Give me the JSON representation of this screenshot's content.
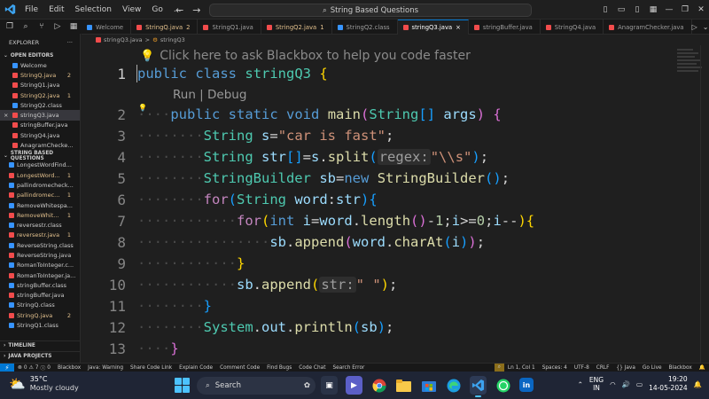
{
  "titlebar": {
    "menu": [
      "File",
      "Edit",
      "Selection",
      "View",
      "Go",
      "..."
    ],
    "search": "String Based Questions"
  },
  "tabs": [
    {
      "label": "Welcome",
      "icon": "vscode-icon",
      "marker": ""
    },
    {
      "label": "StringQ.java",
      "icon": "java-icon",
      "marker": "2",
      "state": "warning"
    },
    {
      "label": "StringQ1.java",
      "icon": "java-icon",
      "marker": ""
    },
    {
      "label": "StringQ2.java",
      "icon": "java-icon",
      "marker": "1",
      "state": "warning"
    },
    {
      "label": "StringQ2.class",
      "icon": "class-icon",
      "marker": ""
    },
    {
      "label": "stringQ3.java",
      "icon": "java-icon",
      "marker": "×",
      "state": "active"
    },
    {
      "label": "stringBuffer.java",
      "icon": "java-icon",
      "marker": ""
    },
    {
      "label": "StringQ4.java",
      "icon": "java-icon",
      "marker": ""
    },
    {
      "label": "AnagramChecker.java",
      "icon": "java-icon",
      "marker": ""
    }
  ],
  "breadcrumb": {
    "file": "stringQ3.java",
    "sep": ">",
    "symbol": "stringQ3"
  },
  "sidebar": {
    "title": "EXPLORER",
    "more": "···",
    "open_editors_title": "OPEN EDITORS",
    "open_editors": [
      {
        "label": "Welcome",
        "icon": "vscode-icon",
        "badge": "",
        "color": "normal"
      },
      {
        "label": "StringQ.java",
        "icon": "java-icon",
        "badge": "2",
        "color": "warn"
      },
      {
        "label": "StringQ1.java",
        "icon": "java-icon",
        "badge": "",
        "color": "normal"
      },
      {
        "label": "StringQ2.java",
        "icon": "java-icon",
        "badge": "1",
        "color": "warn"
      },
      {
        "label": "StringQ2.class",
        "icon": "class-icon",
        "badge": "",
        "color": "normal"
      },
      {
        "label": "stringQ3.java",
        "icon": "java-icon",
        "badge": "",
        "color": "normal",
        "selected": true
      },
      {
        "label": "stringBuffer.java",
        "icon": "java-icon",
        "badge": "",
        "color": "normal"
      },
      {
        "label": "StringQ4.java",
        "icon": "java-icon",
        "badge": "",
        "color": "normal"
      },
      {
        "label": "AnagramChecke...",
        "icon": "java-icon",
        "badge": "",
        "color": "normal"
      }
    ],
    "folder_title": "STRING BASED QUESTIONS",
    "folder_items": [
      {
        "label": "LongestWordFind...",
        "icon": "class-icon",
        "badge": "",
        "color": "normal"
      },
      {
        "label": "LongestWord...",
        "icon": "java-icon",
        "badge": "1",
        "color": "warn"
      },
      {
        "label": "pallindromecheck...",
        "icon": "class-icon",
        "badge": "",
        "color": "normal"
      },
      {
        "label": "pallindromec...",
        "icon": "java-icon",
        "badge": "1",
        "color": "warn"
      },
      {
        "label": "RemoveWhitespa...",
        "icon": "class-icon",
        "badge": "",
        "color": "normal"
      },
      {
        "label": "RemoveWhit...",
        "icon": "java-icon",
        "badge": "1",
        "color": "warn"
      },
      {
        "label": "reversestr.class",
        "icon": "class-icon",
        "badge": "",
        "color": "normal"
      },
      {
        "label": "reversestr.java",
        "icon": "java-icon",
        "badge": "1",
        "color": "warn"
      },
      {
        "label": "ReverseString.class",
        "icon": "class-icon",
        "badge": "",
        "color": "normal"
      },
      {
        "label": "ReverseString.java",
        "icon": "java-icon",
        "badge": "",
        "color": "normal"
      },
      {
        "label": "RomanToInteger.c...",
        "icon": "class-icon",
        "badge": "",
        "color": "normal"
      },
      {
        "label": "RomanToInteger.ja...",
        "icon": "java-icon",
        "badge": "",
        "color": "normal"
      },
      {
        "label": "stringBuffer.class",
        "icon": "class-icon",
        "badge": "",
        "color": "normal"
      },
      {
        "label": "stringBuffer.java",
        "icon": "java-icon",
        "badge": "",
        "color": "normal"
      },
      {
        "label": "StringQ.class",
        "icon": "class-icon",
        "badge": "",
        "color": "normal"
      },
      {
        "label": "StringQ.java",
        "icon": "java-icon",
        "badge": "2",
        "color": "warn"
      },
      {
        "label": "StringQ1.class",
        "icon": "class-icon",
        "badge": "",
        "color": "normal"
      }
    ],
    "timeline": "TIMELINE",
    "java_projects": "JAVA PROJECTS"
  },
  "editor": {
    "hint": "Click here to ask Blackbox to help you code faster",
    "codelens": "Run | Debug",
    "line_numbers": [
      "1",
      "2",
      "3",
      "4",
      "5",
      "6",
      "7",
      "8",
      "9",
      "10",
      "11",
      "12",
      "13"
    ],
    "inlay_regex": "regex:",
    "inlay_str": "str:"
  },
  "statusbar": {
    "errors": "0",
    "warnings": "7",
    "info": "0",
    "left_items": [
      "Blackbox",
      "Java: Warning",
      "Share Code Link",
      "Explain Code",
      "Comment Code",
      "Find Bugs",
      "Code Chat",
      "Search Error"
    ],
    "right_items": [
      "Ln 1, Col 1",
      "Spaces: 4",
      "UTF-8",
      "CRLF",
      "{} Java",
      "Go Live",
      "Blackbox"
    ]
  },
  "taskbar": {
    "temp": "35°C",
    "condition": "Mostly cloudy",
    "search": "Search",
    "lang1": "ENG",
    "lang2": "IN",
    "time": "19:20",
    "date": "14-05-2024"
  },
  "colors": {
    "accent": "#0078d4",
    "warning": "#e2c08d",
    "error": "#f14c4c"
  }
}
